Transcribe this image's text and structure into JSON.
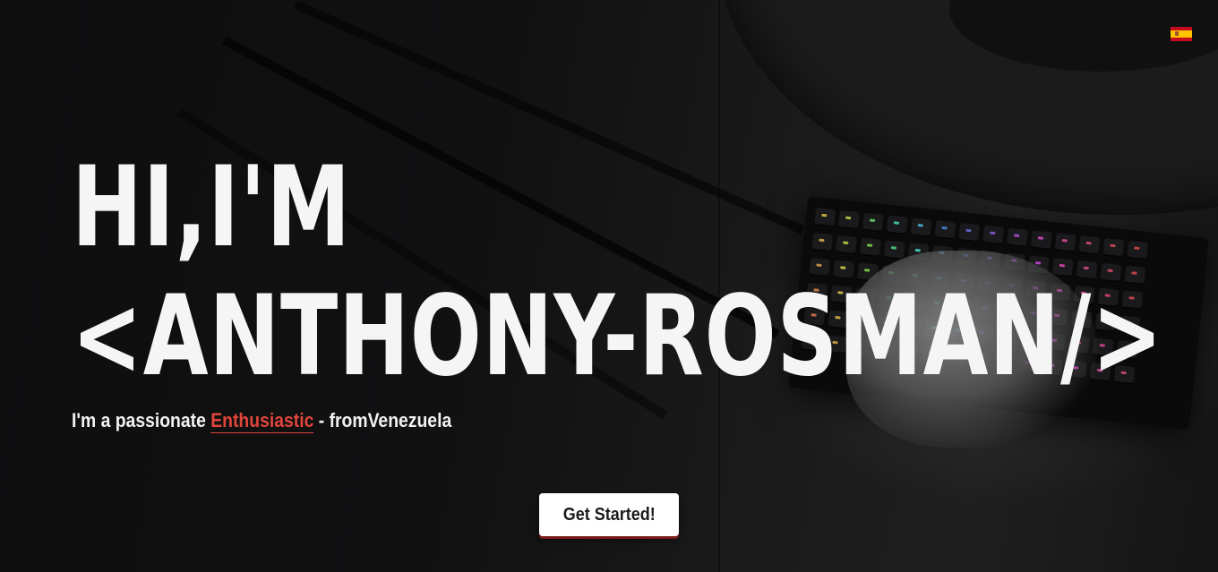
{
  "language_switch": {
    "icon": "spain-flag-icon",
    "colors": {
      "red": "#c60b1e",
      "yellow": "#ffc400"
    }
  },
  "hero": {
    "title_line_1": "HI,I'M",
    "title_line_2": "<ANTHONY-ROSMAN/>",
    "subtitle_prefix": "I'm a passionate ",
    "subtitle_highlight": "Enthusiastic",
    "subtitle_suffix": " - fromVenezuela",
    "cta_label": "Get Started!"
  },
  "theme": {
    "title_color": "#f5f5f5",
    "accent_color": "#e0453b",
    "button_bg": "#ffffff",
    "button_text": "#1b1b1b"
  }
}
